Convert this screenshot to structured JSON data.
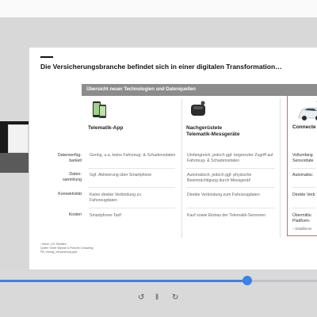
{
  "slide": {
    "title": "Die Versicherungsbranche befindet sich in einer digitalen Transformation…",
    "table_header": "Übersicht neuer Technologien und Datenquellen",
    "columns": [
      {
        "title_line1": "Telematik-App",
        "title_line2": ""
      },
      {
        "title_line1": "Nachgerüstete",
        "title_line2": "Telematik-Messgeräte"
      },
      {
        "title_line1": "Connecte",
        "title_line2": ""
      }
    ],
    "rows": [
      {
        "label_line1": "Datenverfüg-",
        "label_line2": "barkeit",
        "c1": "Gering, u.a. keine Fahrzeug- & Schadensdaten",
        "c2": "Umfangreich, jedoch ggf. begrenzter Zugriff auf Fahrzeug- & Schadensdaten",
        "c3": "Vollumfang Sensordate"
      },
      {
        "label_line1": "Daten-",
        "label_line2": "sammlung",
        "c1": "Ggf. Aktivierung über Smartphone",
        "c2": "Automatisch, jedoch ggf. physische Beeinträchtigung durch Messgerät¹",
        "c3": "Automatisc"
      },
      {
        "label_line1": "Konnektivität",
        "label_line2": "",
        "c1": "Keine direkte Verbindung zu Fahrzeugdaten",
        "c2": "Direkte Verbindung zum Fahrzeugdaten",
        "c3": "Direkte Verb"
      },
      {
        "label_line1": "Kosten",
        "label_line2": "",
        "c1": "Smartphone-Tarif",
        "c2": "Kauf sowie Einbau der Telematik-Sensoren",
        "c3": "Übermittlu Plattform-",
        "c3_sub": "– Detaillierun"
      }
    ],
    "footnotes": [
      "¹ Nutze, z.B. Schalten",
      "Quelle: Oliver Wyman & Porsche Consulting",
      "PB_Vortrag_Versicherung.pptx"
    ]
  },
  "player": {
    "progress": 0.78,
    "controls": {
      "rewind_icon": "↺",
      "pause_icon": "‖",
      "forward_icon": "↻"
    }
  }
}
